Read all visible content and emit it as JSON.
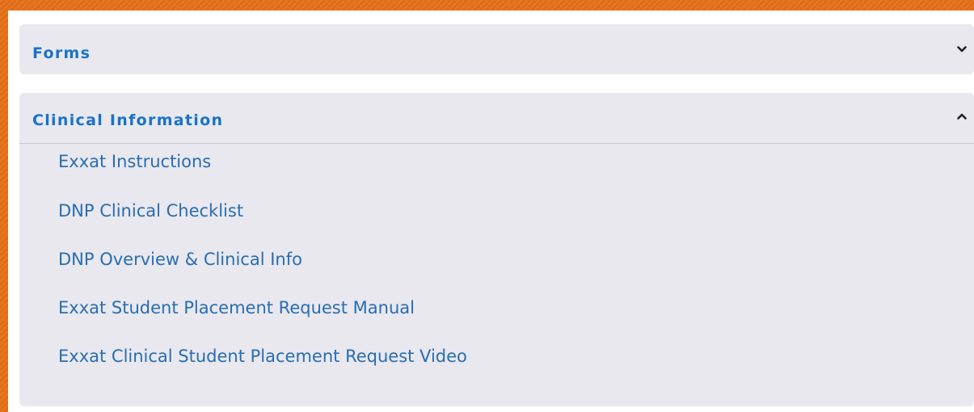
{
  "accordions": {
    "forms": {
      "title": "Forms",
      "expanded": false,
      "chevron": "chevron-down-icon"
    },
    "clinical": {
      "title": "Clinical Information",
      "expanded": true,
      "chevron": "chevron-up-icon",
      "links": [
        "Exxat Instructions",
        "DNP Clinical Checklist",
        "DNP Overview & Clinical Info",
        "Exxat Student Placement Request Manual",
        "Exxat Clinical Student Placement Request Video"
      ]
    }
  },
  "colors": {
    "heading": "#1a73c7",
    "link": "#2a6db0",
    "panel_bg": "#e8e8ee",
    "border_accent": "#e8751f"
  }
}
